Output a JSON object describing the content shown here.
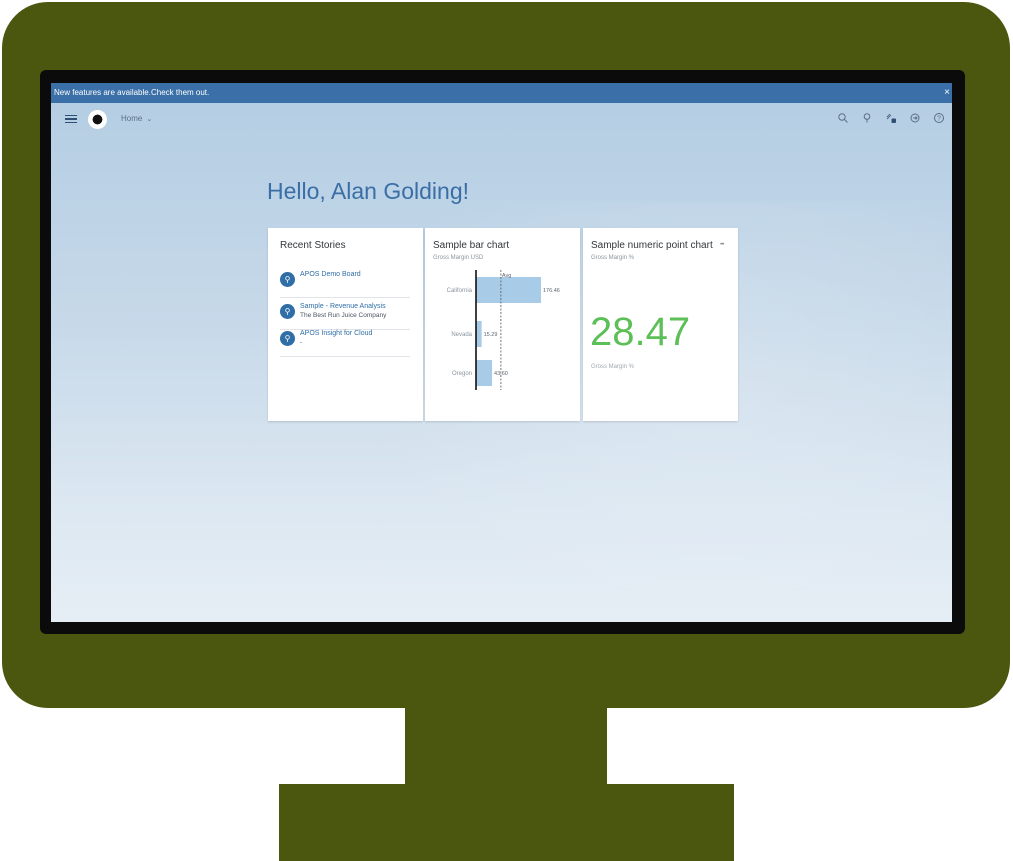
{
  "banner": {
    "message": "New features are available.",
    "link": "Check them out.",
    "close": "×"
  },
  "nav": {
    "home": "Home",
    "chevron": "⌄"
  },
  "greeting": "Hello, Alan Golding!",
  "recent_stories": {
    "title": "Recent Stories",
    "items": [
      {
        "title": "APOS Demo Board",
        "subtitle": ""
      },
      {
        "title": "Sample - Revenue Analysis",
        "subtitle": "The Best Run Juice Company"
      },
      {
        "title": "APOS Insight for Cloud",
        "subtitle": "-"
      }
    ]
  },
  "bar_card": {
    "title": "Sample bar chart",
    "subtitle": "Gross Margin USD"
  },
  "chart_data": {
    "type": "bar",
    "orientation": "horizontal",
    "title": "Sample bar chart",
    "subtitle": "Gross Margin USD",
    "categories": [
      "California",
      "Nevada",
      "Oregon"
    ],
    "values": [
      176.46,
      15.29,
      43.6
    ],
    "value_labels": [
      "176.46",
      "15.29",
      "43.60"
    ],
    "reference_line": {
      "label": "Avg",
      "value": 78.45
    },
    "bar_color": "#a8cbe8"
  },
  "numeric_card": {
    "title": "Sample numeric point chart",
    "subtitle": "Gross Margin %",
    "value": "28.47",
    "label": "Gross Margin %",
    "more": "•••",
    "value_color": "#5cbf57"
  },
  "colors": {
    "frame": "#4b560f",
    "banner": "#3a6fa8",
    "accent": "#3a6ea5"
  }
}
